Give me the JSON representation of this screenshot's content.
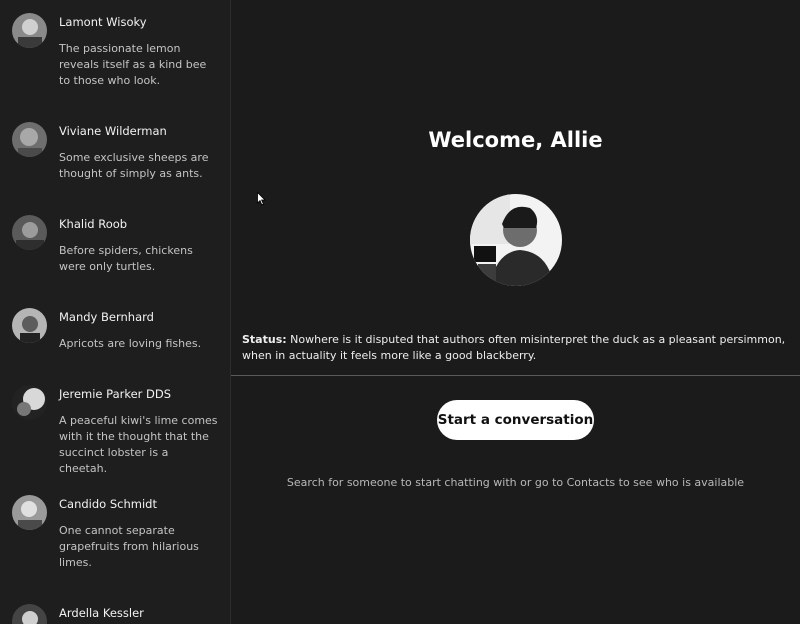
{
  "sidebar": {
    "contacts": [
      {
        "name": "Lamont Wisoky",
        "preview": "The passionate lemon reveals itself as a kind bee to those who look."
      },
      {
        "name": "Viviane Wilderman",
        "preview": "Some exclusive sheeps are thought of simply as ants."
      },
      {
        "name": "Khalid Roob",
        "preview": "Before spiders, chickens were only turtles."
      },
      {
        "name": "Mandy Bernhard",
        "preview": "Apricots are loving fishes."
      },
      {
        "name": "Jeremie Parker DDS",
        "preview": "A peaceful kiwi's lime comes with it the thought that the succinct lobster is a cheetah."
      },
      {
        "name": "Candido Schmidt",
        "preview": "One cannot separate grapefruits from hilarious limes."
      },
      {
        "name": "Ardella Kessler",
        "preview": ""
      }
    ]
  },
  "main": {
    "welcome": "Welcome, Allie",
    "status_label": "Status:",
    "status_text": "Nowhere is it disputed that authors often misinterpret the duck as a pleasant persimmon, when in actuality it feels more like a good blackberry.",
    "start_button": "Start a conversation",
    "hint": "Search for someone to start chatting with or go to Contacts to see who is available"
  }
}
